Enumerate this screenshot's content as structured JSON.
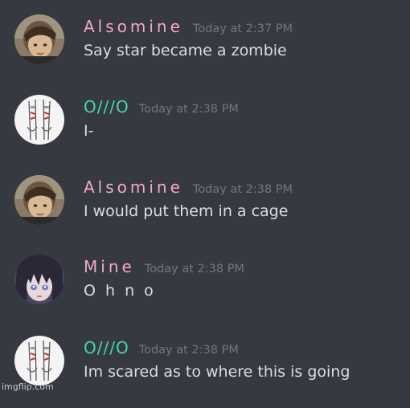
{
  "colors": {
    "background": "#36393f",
    "timestamp": "#72767d",
    "message_text": "#dcddde",
    "pink_name": "#f2a7cf",
    "teal_name": "#43d9b0"
  },
  "messages": [
    {
      "username": "Alsomine",
      "name_color": "#f2a7cf",
      "timestamp": "Today at 2:37 PM",
      "text": "Say star became a zombie",
      "avatar_icon": "photo-avatar-icon"
    },
    {
      "username": "O///O",
      "name_color": "#43d9b0",
      "timestamp": "Today at 2:38 PM",
      "text": "I-",
      "avatar_icon": "sketch-avatar-icon"
    },
    {
      "username": "Alsomine",
      "name_color": "#f2a7cf",
      "timestamp": "Today at 2:38 PM",
      "text": "I would put them in a cage",
      "avatar_icon": "photo-avatar-icon"
    },
    {
      "username": "Mine",
      "name_color": "#f2a7cf",
      "timestamp": "Today at 2:38 PM",
      "text": "O h n o",
      "avatar_icon": "anime-avatar-icon"
    },
    {
      "username": "O///O",
      "name_color": "#43d9b0",
      "timestamp": "Today at 2:38 PM",
      "text": "Im scared as to where this is going",
      "avatar_icon": "sketch-avatar-icon"
    }
  ],
  "watermark": "imgflip.com"
}
